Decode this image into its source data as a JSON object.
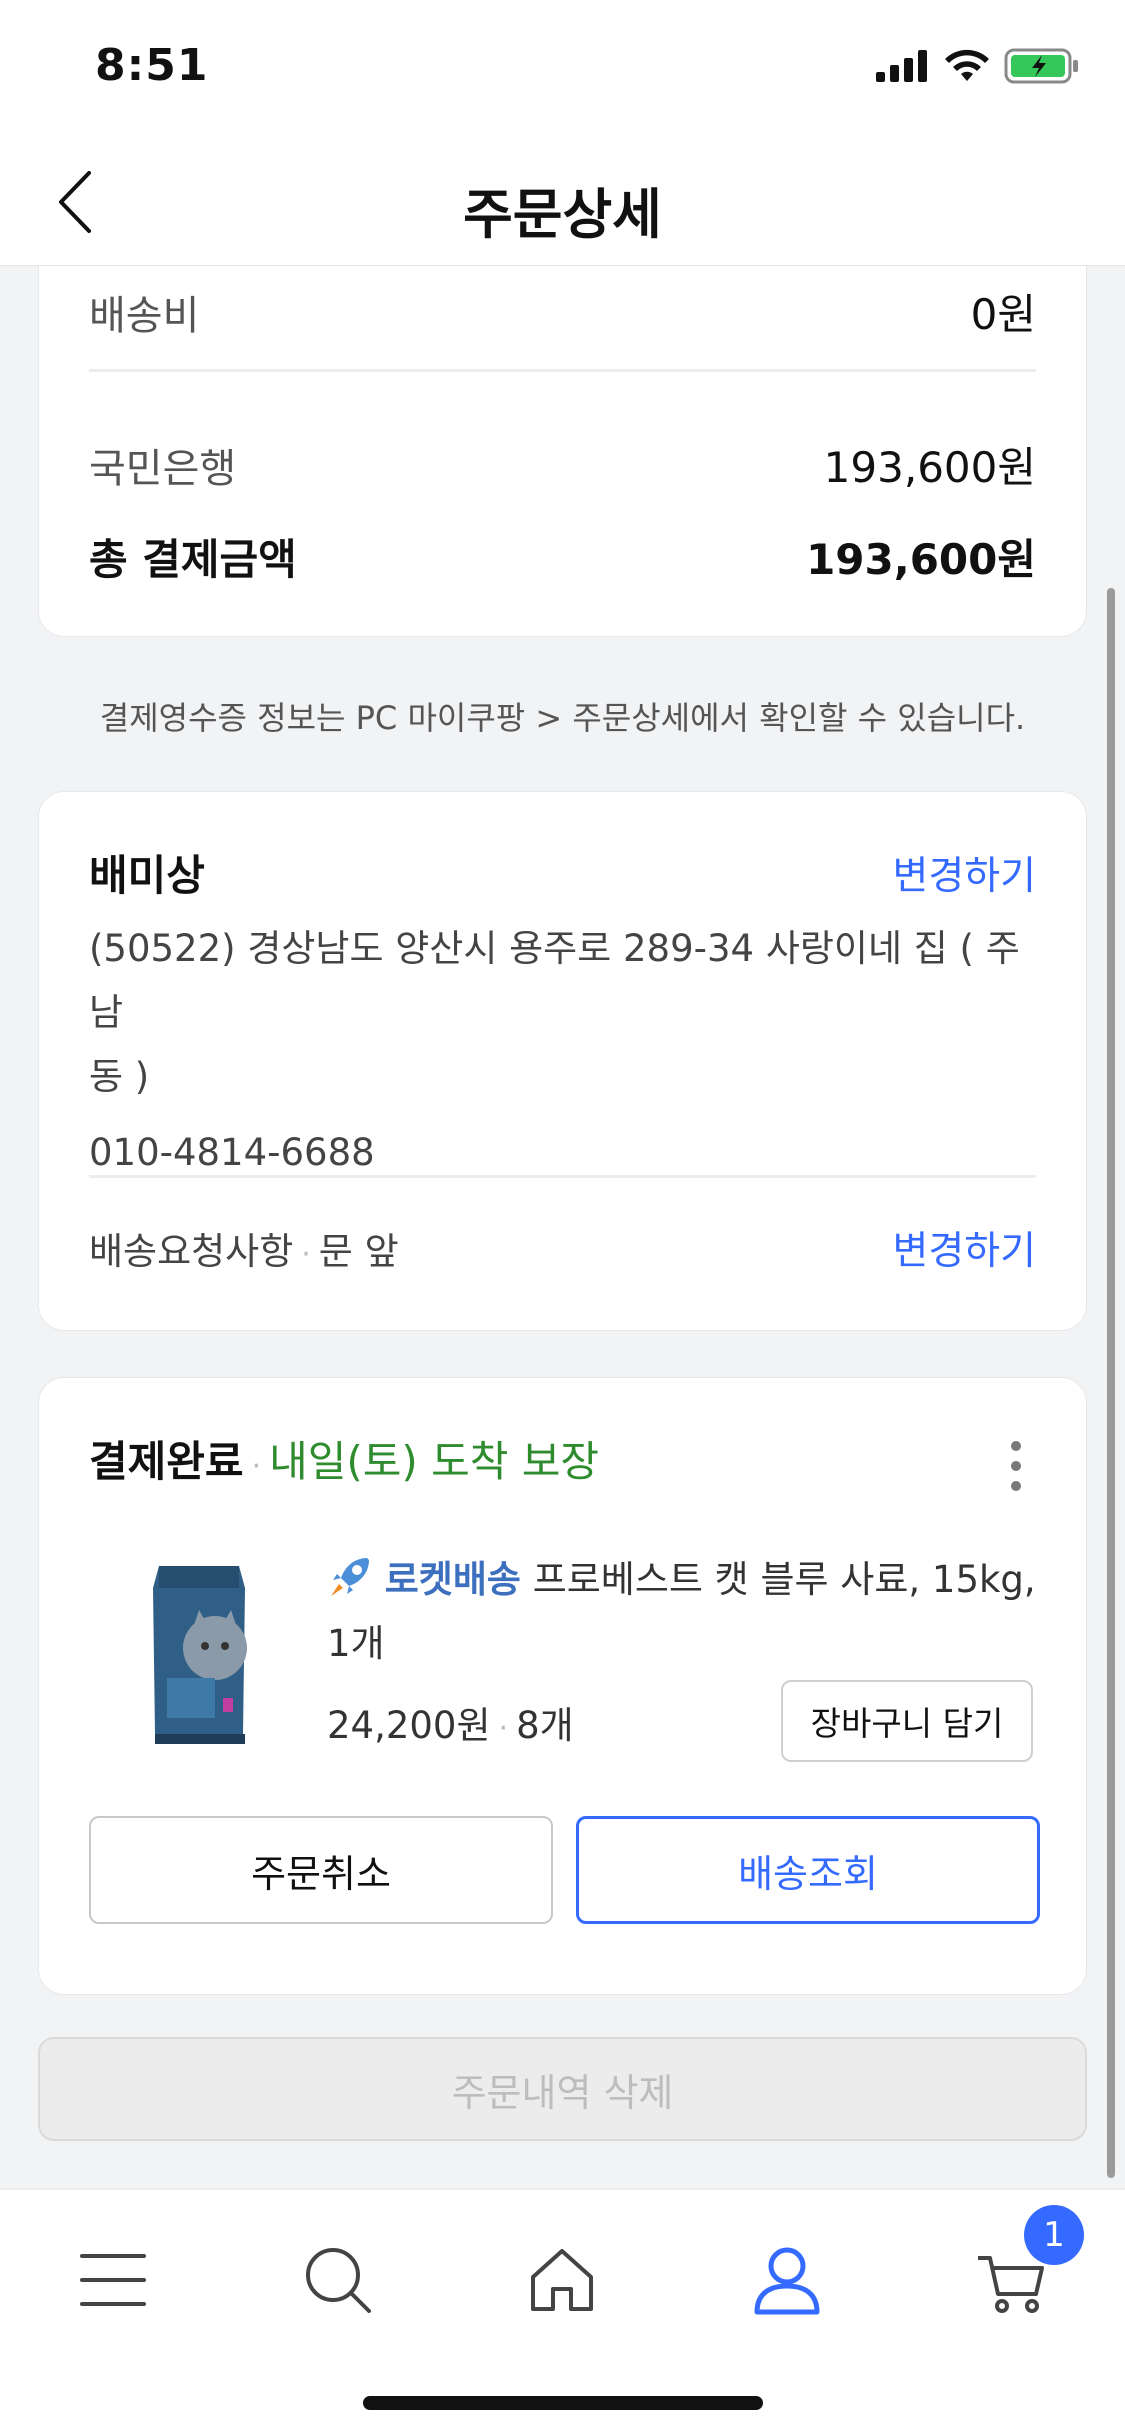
{
  "status": {
    "time": "8:51"
  },
  "nav": {
    "title": "주문상세"
  },
  "payment": {
    "shipping_label": "배송비",
    "shipping_value": "0원",
    "bank_label": "국민은행",
    "bank_value": "193,600원",
    "total_label": "총 결제금액",
    "total_value": "193,600원"
  },
  "receipt_note": "결제영수증 정보는 PC 마이쿠팡 > 주문상세에서 확인할 수 있습니다.",
  "address": {
    "name": "배미상",
    "change_label": "변경하기",
    "line1": "(50522) 경상남도 양산시 용주로 289-34 사랑이네 집 ( 주남",
    "line2": "동 )",
    "phone": "010-4814-6688",
    "request_label": "배송요청사항",
    "request_value": "문 앞",
    "request_change_label": "변경하기"
  },
  "order": {
    "status": "결제완료",
    "delivery_promise": "내일(토) 도착 보장",
    "rocket_label": "로켓배송",
    "product_name": "프로베스트 캣 블루 사료, 15kg,",
    "product_qty_line": "1개",
    "price": "24,200원",
    "count": "8개",
    "cart_button": "장바구니 담기",
    "cancel_button": "주문취소",
    "track_button": "배송조회"
  },
  "delete_button": "주문내역 삭제",
  "tab_bar": {
    "items": [
      "menu-icon",
      "search-icon",
      "home-icon",
      "user-icon",
      "cart-icon"
    ],
    "cart_badge": "1"
  },
  "colors": {
    "accent": "#346aff",
    "green": "#2e8b2e"
  }
}
